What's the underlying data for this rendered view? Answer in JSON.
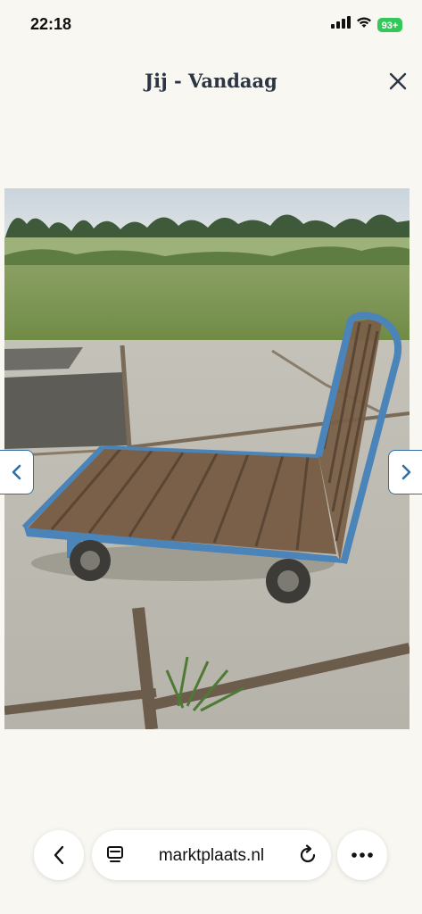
{
  "status_bar": {
    "time": "22:18",
    "battery": "93+",
    "battery_color": "#34c759",
    "icons": [
      "signal-icon",
      "wifi-icon",
      "battery-icon"
    ]
  },
  "header": {
    "title": "Jij - Vandaag",
    "close_icon": "close-icon"
  },
  "viewer": {
    "image_alt": "Blue metal flatbed cart with wooden slat platform on concrete slabs beside a grass field",
    "prev_icon": "chevron-left-icon",
    "next_icon": "chevron-right-icon",
    "accent_color": "#2f6fa5"
  },
  "browser_bar": {
    "url": "marktplaats.nl",
    "back_icon": "chevron-left-icon",
    "page_icon": "page-icon",
    "reload_icon": "reload-icon",
    "more_icon": "more-icon"
  }
}
